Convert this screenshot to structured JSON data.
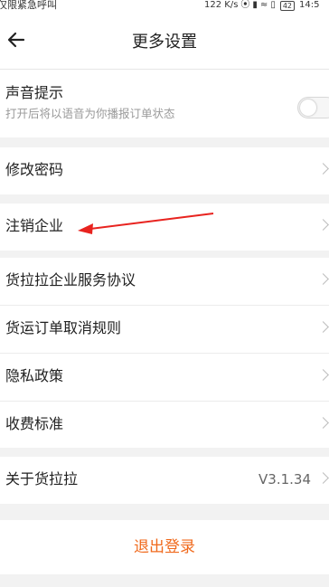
{
  "status_bar": {
    "left_text": "仅限紧急呼叫",
    "network_speed": "122 K/s",
    "battery_level": "42",
    "time": "14:5"
  },
  "header": {
    "title": "更多设置"
  },
  "sound": {
    "title": "声音提示",
    "subtitle": "打开后将以语音为你播报订单状态",
    "enabled": false
  },
  "rows": {
    "change_password": "修改密码",
    "cancel_enterprise": "注销企业",
    "service_agreement": "货拉拉企业服务协议",
    "cancel_rules": "货运订单取消规则",
    "privacy_policy": "隐私政策",
    "fee_standard": "收费标准",
    "about": "关于货拉拉",
    "about_version": "V3.1.34"
  },
  "logout_label": "退出登录",
  "colors": {
    "accent": "#f06a1d",
    "annotation_arrow": "#e8231f",
    "background": "#f2f2f2"
  }
}
